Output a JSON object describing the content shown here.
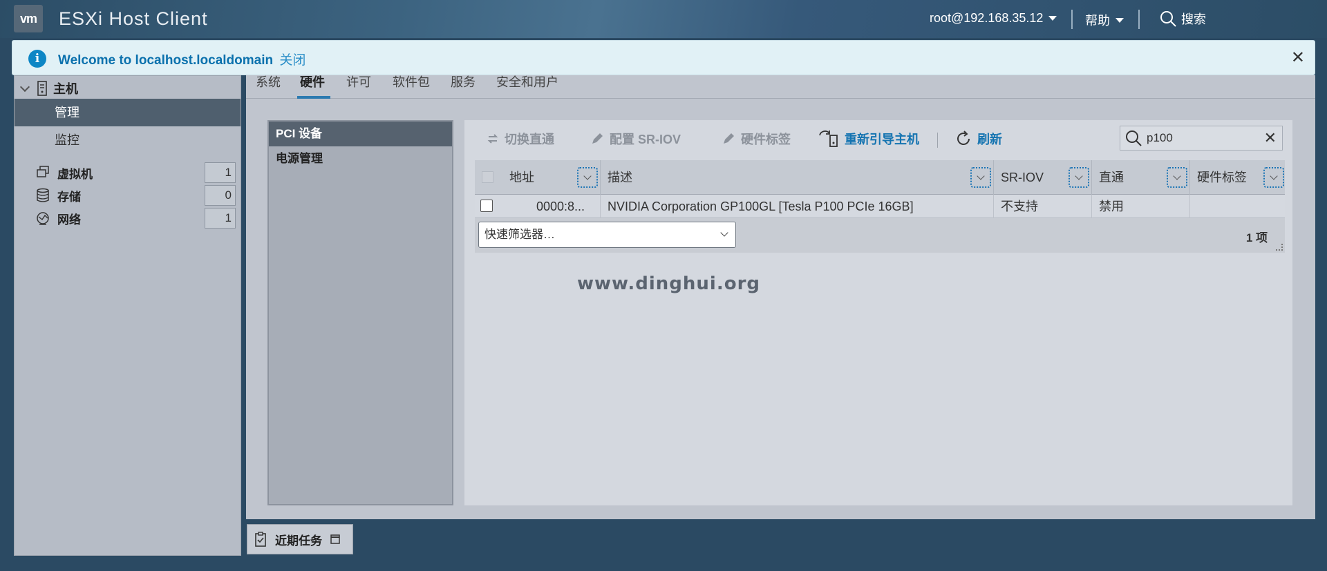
{
  "header": {
    "logo_text": "vm",
    "app_title": "ESXi Host Client",
    "user": "root@192.168.35.12",
    "help": "帮助",
    "search": "搜索"
  },
  "banner": {
    "message": "Welcome to localhost.localdomain",
    "close_link": "关闭"
  },
  "sidebar": {
    "host_label": "主机",
    "manage_label": "管理",
    "monitor_label": "监控",
    "items": [
      {
        "label": "虚拟机",
        "count": "1",
        "icon": "vm-icon"
      },
      {
        "label": "存储",
        "count": "0",
        "icon": "storage-icon"
      },
      {
        "label": "网络",
        "count": "1",
        "icon": "network-icon"
      }
    ]
  },
  "tabs": [
    {
      "label": "系统",
      "active": false
    },
    {
      "label": "硬件",
      "active": true
    },
    {
      "label": "许可",
      "active": false
    },
    {
      "label": "软件包",
      "active": false
    },
    {
      "label": "服务",
      "active": false
    },
    {
      "label": "安全和用户",
      "active": false
    }
  ],
  "subnav": [
    {
      "label": "PCI 设备",
      "active": true
    },
    {
      "label": "电源管理",
      "active": false
    }
  ],
  "toolbar": {
    "toggle_passthrough": "切换直通",
    "configure_sriov": "配置 SR-IOV",
    "hardware_label": "硬件标签",
    "reboot_host": "重新引导主机",
    "refresh": "刷新",
    "search_value": "p100"
  },
  "table": {
    "columns": [
      "地址",
      "描述",
      "SR-IOV",
      "直通",
      "硬件标签"
    ],
    "rows": [
      {
        "address": "0000:8...",
        "description": "NVIDIA Corporation GP100GL [Tesla P100 PCIe 16GB]",
        "sriov": "不支持",
        "passthrough": "禁用",
        "label": ""
      }
    ],
    "quick_filter": "快速筛选器…",
    "count": "1 项"
  },
  "watermark": "www.dinghui.org",
  "tasks": {
    "label": "近期任务"
  },
  "colors": {
    "accent": "#1574b1",
    "header_bg": "#2c4d66",
    "selected_nav": "#4f5f6e"
  }
}
